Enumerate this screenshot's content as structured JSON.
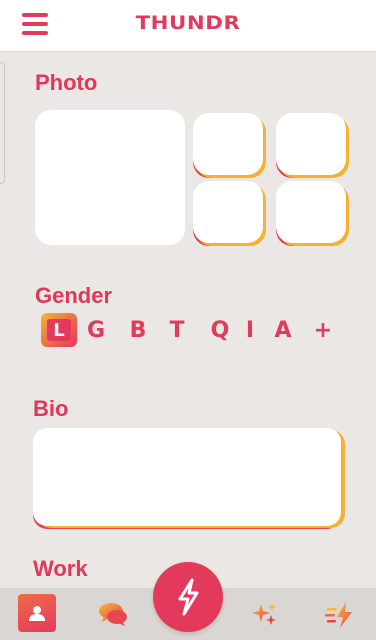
{
  "app": {
    "brand": "THUNDR"
  },
  "sections": {
    "photo": "Photo",
    "gender": "Gender",
    "bio": "Bio",
    "work": "Work"
  },
  "gender_options": [
    "L",
    "G",
    "B",
    "T",
    "Q",
    "I",
    "A",
    "+"
  ],
  "gender_selected": "L",
  "bio_value": "",
  "nav": {
    "items": [
      "profile-icon",
      "chat-icon",
      "thunder-icon",
      "sparkles-icon",
      "boost-icon"
    ],
    "active": "profile-icon"
  },
  "colors": {
    "accent": "#e33a5c",
    "gradient_yellow": "#f4b233",
    "background": "#ebe7e4"
  }
}
